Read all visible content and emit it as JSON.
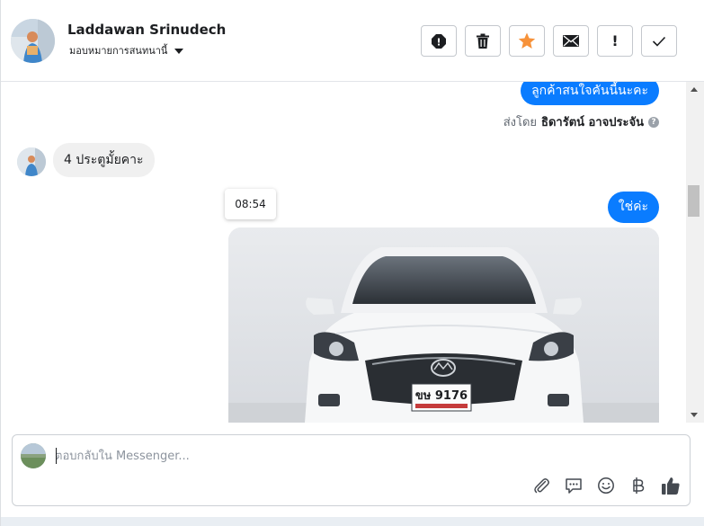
{
  "header": {
    "name": "Laddawan Srinudech",
    "assign_label": "มอบหมายการสนทนานี้"
  },
  "messages": {
    "outgoing_1": "ลูกค้าสนใจคันนี้นะคะ",
    "sent_by_prefix": "ส่งโดย",
    "sent_by_name": "ธิดารัตน์ อาจประจัน",
    "help_glyph": "?",
    "incoming_1": "4 ประตูมั้ยคาะ",
    "timestamp": "08:54",
    "outgoing_2": "ใช่ค่ะ",
    "photo_plate": "ขษ 9176"
  },
  "composer": {
    "placeholder": "ตอบกลับใน Messenger..."
  },
  "actions": {
    "spam_glyph": "!",
    "flag_glyph": "!"
  },
  "colors": {
    "accent": "#0a7cff",
    "star": "#f7923a"
  }
}
